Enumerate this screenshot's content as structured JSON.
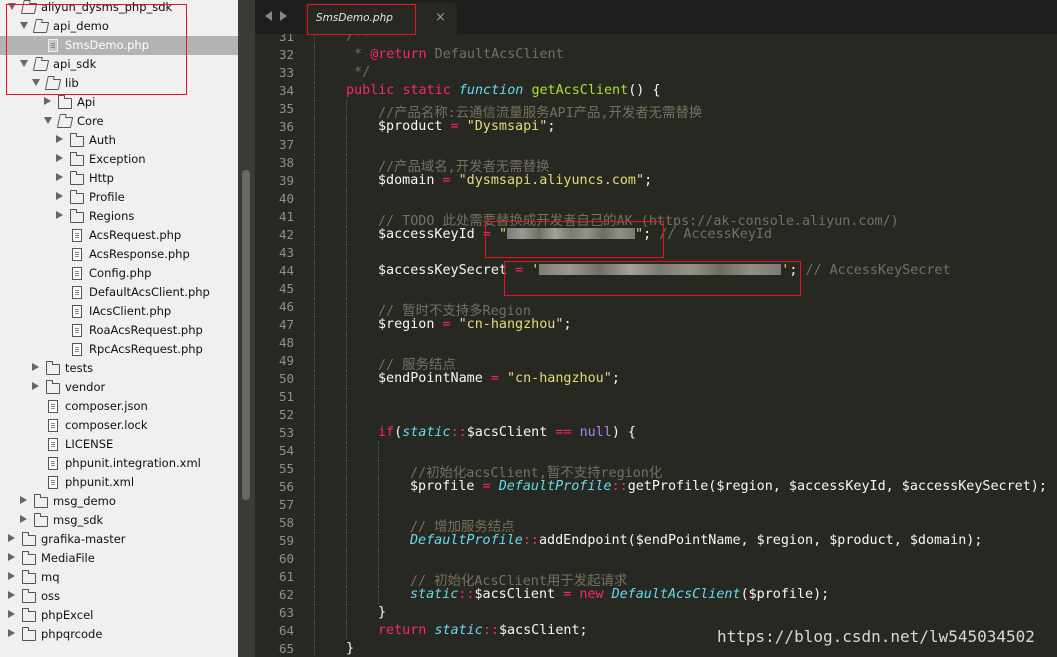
{
  "sidebar": {
    "tree": [
      {
        "label": "aliyun_dysms_php_sdk",
        "type": "folder",
        "depth": 0,
        "expanded": true
      },
      {
        "label": "api_demo",
        "type": "folder",
        "depth": 1,
        "expanded": true
      },
      {
        "label": "SmsDemo.php",
        "type": "file",
        "depth": 2,
        "selected": true
      },
      {
        "label": "api_sdk",
        "type": "folder",
        "depth": 1,
        "expanded": true
      },
      {
        "label": "lib",
        "type": "folder",
        "depth": 2,
        "expanded": true
      },
      {
        "label": "Api",
        "type": "folder",
        "depth": 3,
        "expanded": false
      },
      {
        "label": "Core",
        "type": "folder",
        "depth": 3,
        "expanded": true
      },
      {
        "label": "Auth",
        "type": "folder",
        "depth": 4,
        "expanded": false
      },
      {
        "label": "Exception",
        "type": "folder",
        "depth": 4,
        "expanded": false
      },
      {
        "label": "Http",
        "type": "folder",
        "depth": 4,
        "expanded": false
      },
      {
        "label": "Profile",
        "type": "folder",
        "depth": 4,
        "expanded": false
      },
      {
        "label": "Regions",
        "type": "folder",
        "depth": 4,
        "expanded": false
      },
      {
        "label": "AcsRequest.php",
        "type": "file",
        "depth": 4
      },
      {
        "label": "AcsResponse.php",
        "type": "file",
        "depth": 4
      },
      {
        "label": "Config.php",
        "type": "file",
        "depth": 4
      },
      {
        "label": "DefaultAcsClient.php",
        "type": "file",
        "depth": 4
      },
      {
        "label": "IAcsClient.php",
        "type": "file",
        "depth": 4
      },
      {
        "label": "RoaAcsRequest.php",
        "type": "file",
        "depth": 4
      },
      {
        "label": "RpcAcsRequest.php",
        "type": "file",
        "depth": 4
      },
      {
        "label": "tests",
        "type": "folder",
        "depth": 2,
        "expanded": false
      },
      {
        "label": "vendor",
        "type": "folder",
        "depth": 2,
        "expanded": false
      },
      {
        "label": "composer.json",
        "type": "file",
        "depth": 2
      },
      {
        "label": "composer.lock",
        "type": "file",
        "depth": 2
      },
      {
        "label": "LICENSE",
        "type": "file",
        "depth": 2
      },
      {
        "label": "phpunit.integration.xml",
        "type": "file",
        "depth": 2
      },
      {
        "label": "phpunit.xml",
        "type": "file",
        "depth": 2
      },
      {
        "label": "msg_demo",
        "type": "folder",
        "depth": 1,
        "expanded": false
      },
      {
        "label": "msg_sdk",
        "type": "folder",
        "depth": 1,
        "expanded": false
      },
      {
        "label": "grafika-master",
        "type": "folder",
        "depth": 0,
        "expanded": false
      },
      {
        "label": "MediaFile",
        "type": "folder",
        "depth": 0,
        "expanded": false
      },
      {
        "label": "mq",
        "type": "folder",
        "depth": 0,
        "expanded": false
      },
      {
        "label": "oss",
        "type": "folder",
        "depth": 0,
        "expanded": false
      },
      {
        "label": "phpExcel",
        "type": "folder",
        "depth": 0,
        "expanded": false
      },
      {
        "label": "phpqrcode",
        "type": "folder",
        "depth": 0,
        "expanded": false
      }
    ]
  },
  "tabbar": {
    "active_tab": "SmsDemo.php",
    "close_glyph": "×"
  },
  "editor": {
    "lines": [
      {
        "n": "31",
        "indent": 1,
        "parts": [
          {
            "t": "c",
            "v": "/**"
          }
        ]
      },
      {
        "n": "32",
        "indent": 1,
        "parts": [
          {
            "t": "c",
            "v": " * "
          },
          {
            "t": "k",
            "v": "@return"
          },
          {
            "t": "c",
            "v": " DefaultAcsClient"
          }
        ]
      },
      {
        "n": "33",
        "indent": 1,
        "parts": [
          {
            "t": "c",
            "v": " */"
          }
        ]
      },
      {
        "n": "34",
        "indent": 1,
        "parts": [
          {
            "t": "k",
            "v": "public"
          },
          {
            "t": "p",
            "v": " "
          },
          {
            "t": "k",
            "v": "static"
          },
          {
            "t": "p",
            "v": " "
          },
          {
            "t": "t",
            "v": "function"
          },
          {
            "t": "p",
            "v": " "
          },
          {
            "t": "f",
            "v": "getAcsClient"
          },
          {
            "t": "p",
            "v": "() {"
          }
        ]
      },
      {
        "n": "35",
        "indent": 2,
        "parts": [
          {
            "t": "c",
            "v": "//产品名称:云通信流量服务API产品,开发者无需替换"
          }
        ]
      },
      {
        "n": "36",
        "indent": 2,
        "parts": [
          {
            "t": "p",
            "v": "$product "
          },
          {
            "t": "k",
            "v": "="
          },
          {
            "t": "p",
            "v": " "
          },
          {
            "t": "s",
            "v": "\"Dysmsapi\""
          },
          {
            "t": "p",
            "v": ";"
          }
        ]
      },
      {
        "n": "37",
        "indent": 2,
        "parts": []
      },
      {
        "n": "38",
        "indent": 2,
        "parts": [
          {
            "t": "c",
            "v": "//产品域名,开发者无需替换"
          }
        ]
      },
      {
        "n": "39",
        "indent": 2,
        "parts": [
          {
            "t": "p",
            "v": "$domain "
          },
          {
            "t": "k",
            "v": "="
          },
          {
            "t": "p",
            "v": " "
          },
          {
            "t": "s",
            "v": "\"dysmsapi.aliyuncs.com\""
          },
          {
            "t": "p",
            "v": ";"
          }
        ]
      },
      {
        "n": "40",
        "indent": 2,
        "parts": []
      },
      {
        "n": "41",
        "indent": 2,
        "parts": [
          {
            "t": "c",
            "v": "// TODO 此处需要替换成开发者自己的AK (https://ak-console.aliyun.com/)"
          }
        ]
      },
      {
        "n": "42",
        "indent": 2,
        "parts": [
          {
            "t": "p",
            "v": "$accessKeyId "
          },
          {
            "t": "k",
            "v": "="
          },
          {
            "t": "p",
            "v": " "
          },
          {
            "t": "s",
            "v": "\""
          },
          {
            "t": "blur",
            "v": "128"
          },
          {
            "t": "s",
            "v": "\""
          },
          {
            "t": "p",
            "v": "; "
          },
          {
            "t": "c",
            "v": "// AccessKeyId"
          }
        ]
      },
      {
        "n": "43",
        "indent": 2,
        "parts": []
      },
      {
        "n": "44",
        "indent": 2,
        "parts": [
          {
            "t": "p",
            "v": "$accessKeySecret "
          },
          {
            "t": "k",
            "v": "="
          },
          {
            "t": "p",
            "v": " "
          },
          {
            "t": "s",
            "v": "'"
          },
          {
            "t": "blur",
            "v": "242"
          },
          {
            "t": "s",
            "v": "'"
          },
          {
            "t": "p",
            "v": "; "
          },
          {
            "t": "c",
            "v": "// AccessKeySecret"
          }
        ]
      },
      {
        "n": "45",
        "indent": 2,
        "parts": []
      },
      {
        "n": "46",
        "indent": 2,
        "parts": [
          {
            "t": "c",
            "v": "// 暂时不支持多Region"
          }
        ]
      },
      {
        "n": "47",
        "indent": 2,
        "parts": [
          {
            "t": "p",
            "v": "$region "
          },
          {
            "t": "k",
            "v": "="
          },
          {
            "t": "p",
            "v": " "
          },
          {
            "t": "s",
            "v": "\"cn-hangzhou\""
          },
          {
            "t": "p",
            "v": ";"
          }
        ]
      },
      {
        "n": "48",
        "indent": 2,
        "parts": []
      },
      {
        "n": "49",
        "indent": 2,
        "parts": [
          {
            "t": "c",
            "v": "// 服务结点"
          }
        ]
      },
      {
        "n": "50",
        "indent": 2,
        "parts": [
          {
            "t": "p",
            "v": "$endPointName "
          },
          {
            "t": "k",
            "v": "="
          },
          {
            "t": "p",
            "v": " "
          },
          {
            "t": "s",
            "v": "\"cn-hangzhou\""
          },
          {
            "t": "p",
            "v": ";"
          }
        ]
      },
      {
        "n": "51",
        "indent": 2,
        "parts": []
      },
      {
        "n": "52",
        "indent": 2,
        "parts": []
      },
      {
        "n": "53",
        "indent": 2,
        "parts": [
          {
            "t": "k",
            "v": "if"
          },
          {
            "t": "p",
            "v": "("
          },
          {
            "t": "t",
            "v": "static"
          },
          {
            "t": "k",
            "v": "::"
          },
          {
            "t": "p",
            "v": "$acsClient "
          },
          {
            "t": "k",
            "v": "=="
          },
          {
            "t": "p",
            "v": " "
          },
          {
            "t": "n",
            "v": "null"
          },
          {
            "t": "p",
            "v": ") {"
          }
        ]
      },
      {
        "n": "54",
        "indent": 3,
        "parts": []
      },
      {
        "n": "55",
        "indent": 3,
        "parts": [
          {
            "t": "c",
            "v": "//初始化acsClient,暂不支持region化"
          }
        ]
      },
      {
        "n": "56",
        "indent": 3,
        "parts": [
          {
            "t": "p",
            "v": "$profile "
          },
          {
            "t": "k",
            "v": "="
          },
          {
            "t": "p",
            "v": " "
          },
          {
            "t": "t",
            "v": "DefaultProfile"
          },
          {
            "t": "k",
            "v": "::"
          },
          {
            "t": "p",
            "v": "getProfile($region, $accessKeyId, $accessKeySecret);"
          }
        ]
      },
      {
        "n": "57",
        "indent": 3,
        "parts": []
      },
      {
        "n": "58",
        "indent": 3,
        "parts": [
          {
            "t": "c",
            "v": "// 增加服务结点"
          }
        ]
      },
      {
        "n": "59",
        "indent": 3,
        "parts": [
          {
            "t": "t",
            "v": "DefaultProfile"
          },
          {
            "t": "k",
            "v": "::"
          },
          {
            "t": "p",
            "v": "addEndpoint($endPointName, $region, $product, $domain);"
          }
        ]
      },
      {
        "n": "60",
        "indent": 3,
        "parts": []
      },
      {
        "n": "61",
        "indent": 3,
        "parts": [
          {
            "t": "c",
            "v": "// 初始化AcsClient用于发起请求"
          }
        ]
      },
      {
        "n": "62",
        "indent": 3,
        "parts": [
          {
            "t": "t",
            "v": "static"
          },
          {
            "t": "k",
            "v": "::"
          },
          {
            "t": "p",
            "v": "$acsClient "
          },
          {
            "t": "k",
            "v": "="
          },
          {
            "t": "p",
            "v": " "
          },
          {
            "t": "k",
            "v": "new"
          },
          {
            "t": "p",
            "v": " "
          },
          {
            "t": "t",
            "v": "DefaultAcsClient"
          },
          {
            "t": "p",
            "v": "($profile);"
          }
        ]
      },
      {
        "n": "63",
        "indent": 2,
        "parts": [
          {
            "t": "p",
            "v": "}"
          }
        ]
      },
      {
        "n": "64",
        "indent": 2,
        "parts": [
          {
            "t": "k",
            "v": "return"
          },
          {
            "t": "p",
            "v": " "
          },
          {
            "t": "t",
            "v": "static"
          },
          {
            "t": "k",
            "v": "::"
          },
          {
            "t": "p",
            "v": "$acsClient;"
          }
        ]
      },
      {
        "n": "65",
        "indent": 1,
        "parts": [
          {
            "t": "p",
            "v": "}"
          }
        ]
      }
    ]
  },
  "watermark": "https://blog.csdn.net/lw545034502",
  "colors": {
    "editor_bg": "#272822",
    "keyword": "#f92672",
    "function": "#a6e22e",
    "string": "#e6db74",
    "comment": "#75715e",
    "type": "#66d9ef",
    "constant": "#ae81ff",
    "annotation": "#e8141a",
    "selection": "#b3b3b3"
  }
}
